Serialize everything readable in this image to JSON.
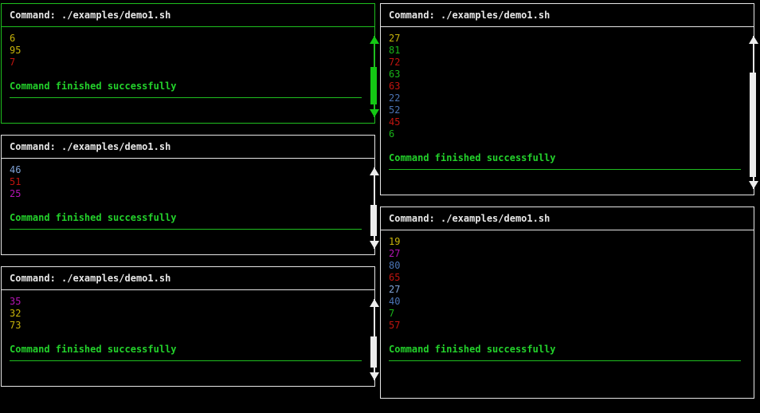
{
  "panes": [
    {
      "id": "pane-top-left",
      "focused": true,
      "title": "Command: ./examples/demo1.sh",
      "lines": [
        {
          "text": "6",
          "color": "yellow"
        },
        {
          "text": "95",
          "color": "yellow"
        },
        {
          "text": "7",
          "color": "red"
        }
      ],
      "status": "Command finished successfully",
      "scrollbar": {
        "visible": true,
        "thumb_start": 0.35,
        "thumb_end": 0.95
      }
    },
    {
      "id": "pane-mid-left",
      "focused": false,
      "title": "Command: ./examples/demo1.sh",
      "lines": [
        {
          "text": "46",
          "color": "lightblue"
        },
        {
          "text": "51",
          "color": "red"
        },
        {
          "text": "25",
          "color": "magenta"
        }
      ],
      "status": "Command finished successfully",
      "scrollbar": {
        "visible": true,
        "thumb_start": 0.45,
        "thumb_end": 0.95
      }
    },
    {
      "id": "pane-bottom-left",
      "focused": false,
      "title": "Command: ./examples/demo1.sh",
      "lines": [
        {
          "text": "35",
          "color": "magenta"
        },
        {
          "text": "32",
          "color": "yellow"
        },
        {
          "text": "73",
          "color": "yellow"
        }
      ],
      "status": "Command finished successfully",
      "scrollbar": {
        "visible": true,
        "thumb_start": 0.45,
        "thumb_end": 0.95
      }
    },
    {
      "id": "pane-top-right",
      "focused": false,
      "title": "Command: ./examples/demo1.sh",
      "lines": [
        {
          "text": "27",
          "color": "yellow"
        },
        {
          "text": "81",
          "color": "green"
        },
        {
          "text": "72",
          "color": "red"
        },
        {
          "text": "63",
          "color": "green"
        },
        {
          "text": "63",
          "color": "red"
        },
        {
          "text": "22",
          "color": "blue"
        },
        {
          "text": "52",
          "color": "blue"
        },
        {
          "text": "45",
          "color": "red"
        },
        {
          "text": "6",
          "color": "green"
        }
      ],
      "status": "Command finished successfully",
      "scrollbar": {
        "visible": true,
        "thumb_start": 0.2,
        "thumb_end": 0.98
      }
    },
    {
      "id": "pane-bottom-right",
      "focused": false,
      "title": "Command: ./examples/demo1.sh",
      "lines": [
        {
          "text": "19",
          "color": "yellow"
        },
        {
          "text": "27",
          "color": "magenta"
        },
        {
          "text": "80",
          "color": "blue"
        },
        {
          "text": "65",
          "color": "red"
        },
        {
          "text": "27",
          "color": "lightblue"
        },
        {
          "text": "40",
          "color": "blue"
        },
        {
          "text": "7",
          "color": "green"
        },
        {
          "text": "57",
          "color": "red"
        }
      ],
      "status": "Command finished successfully",
      "scrollbar": {
        "visible": false
      }
    }
  ],
  "colors": {
    "focus_border": "#1fbf1f",
    "border": "#e6e6e6",
    "status": "#23d12b"
  }
}
